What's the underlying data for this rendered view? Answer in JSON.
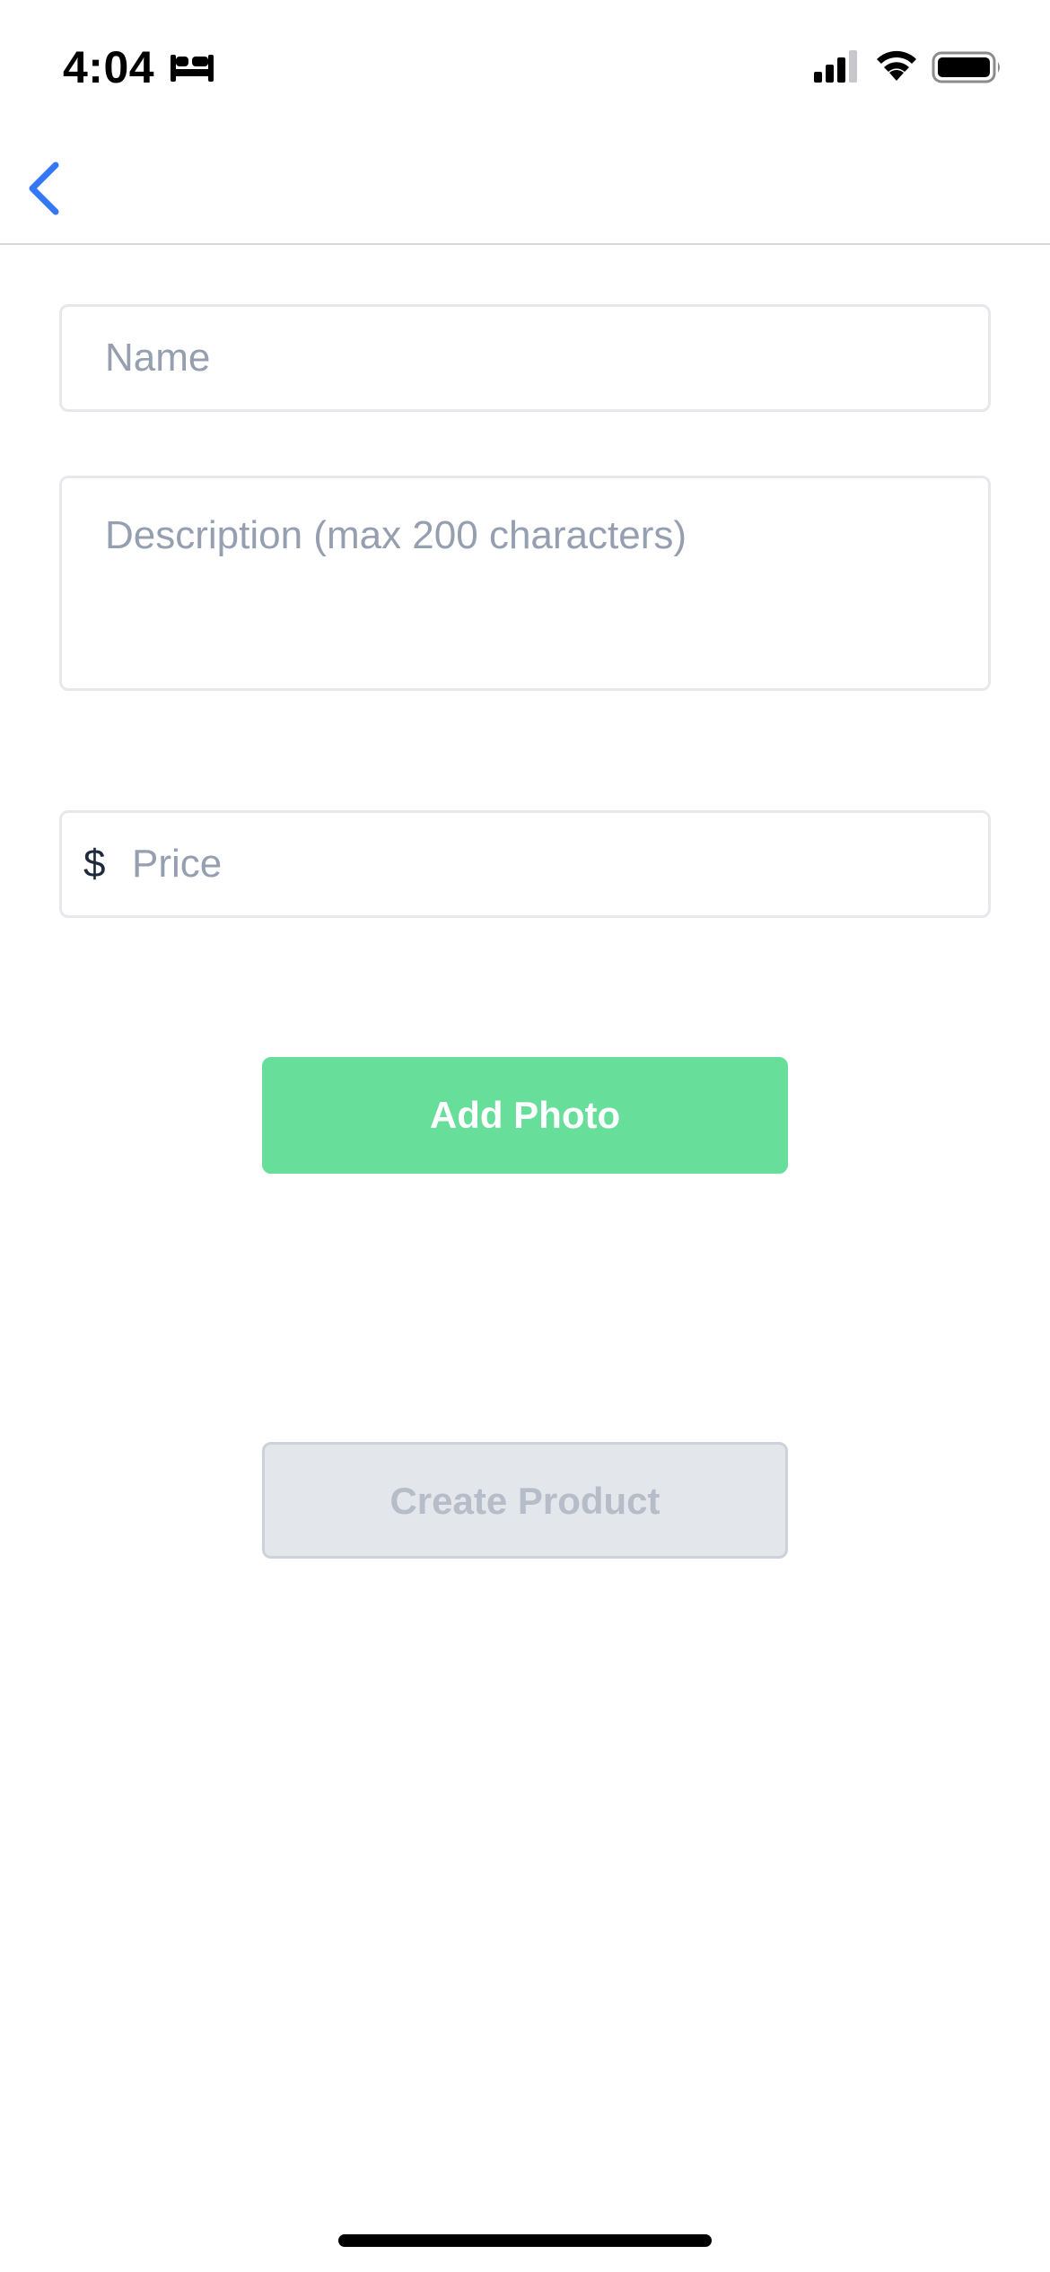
{
  "status_bar": {
    "time": "4:04",
    "icons": [
      "sleep-focus-icon",
      "cellular-signal-icon",
      "wifi-icon",
      "battery-icon"
    ]
  },
  "nav": {
    "back_icon": "chevron-left-icon",
    "accent_color": "#3478f6"
  },
  "form": {
    "name": {
      "value": "",
      "placeholder": "Name"
    },
    "description": {
      "value": "",
      "placeholder": "Description (max 200 characters)"
    },
    "price": {
      "currency_symbol": "$",
      "value": "",
      "placeholder": "Price"
    },
    "add_photo_label": "Add Photo",
    "create_product_label": "Create Product"
  },
  "colors": {
    "add_photo_bg": "#68de9b",
    "create_product_disabled_bg": "#e3e6eb",
    "placeholder_text": "#959fb0",
    "field_border": "#e6e8ec"
  }
}
